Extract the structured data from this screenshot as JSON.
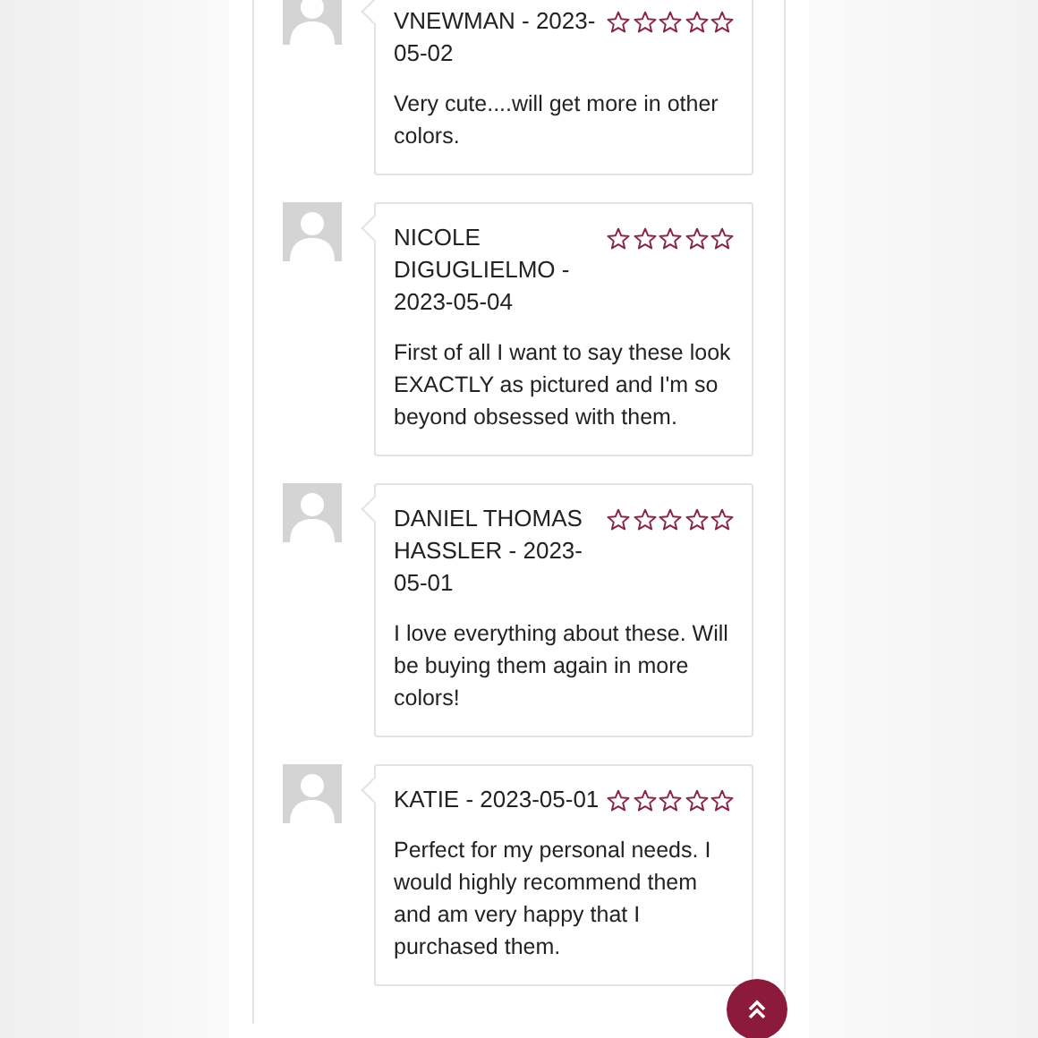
{
  "reviews": [
    {
      "author_line": "VNEWMAN - 2023-05-02",
      "stars": 0,
      "text": "Very cute....will get more in other colors."
    },
    {
      "author_line": "NICOLE DIGUGLIELMO - 2023-05-04",
      "stars": 0,
      "text": "First of all I want to say these look EXACTLY as pictured and I'm so beyond obsessed with them."
    },
    {
      "author_line": "DANIEL THOMAS HASSLER - 2023-05-01",
      "stars": 0,
      "text": "I love everything about these. Will be buying them again in more colors!"
    },
    {
      "author_line": "KATIE - 2023-05-01",
      "stars": 0,
      "text": "Perfect for my personal needs. I would highly recommend them and am very happy that I purchased them."
    }
  ]
}
